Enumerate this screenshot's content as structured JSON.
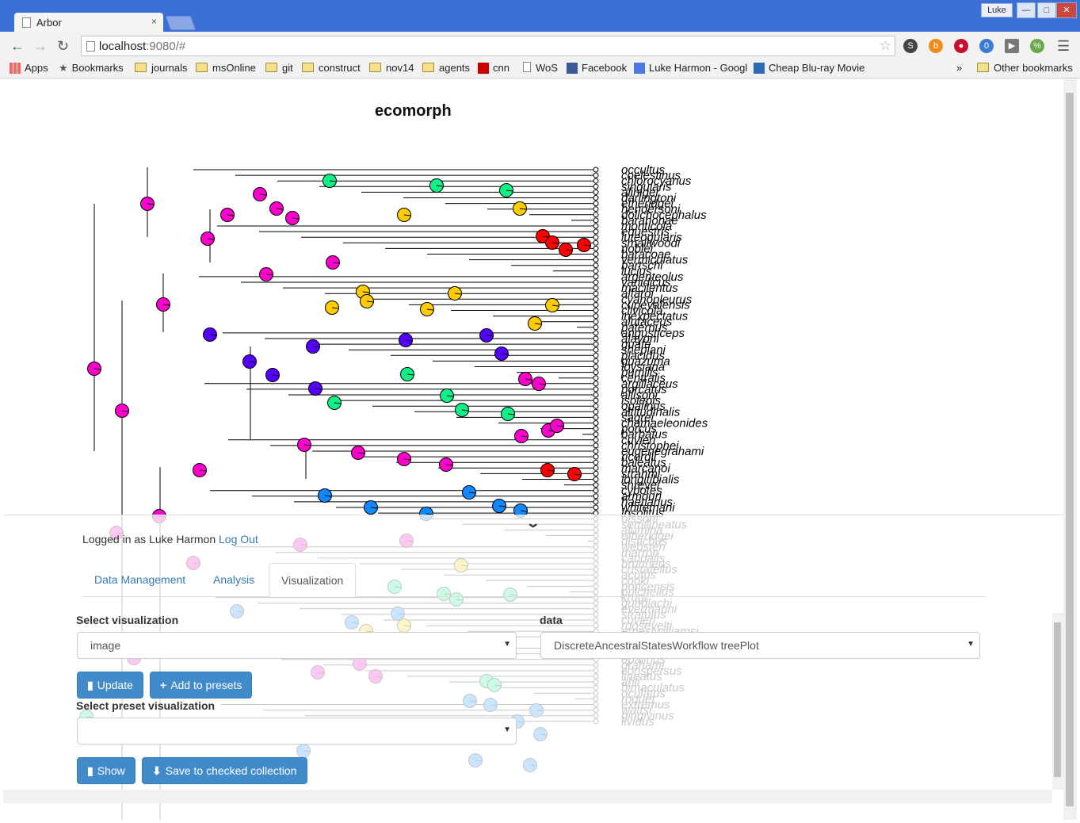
{
  "browser": {
    "tab_title": "Arbor",
    "tab_close": "×",
    "user": "Luke",
    "url_host": "localhost",
    "url_rest": ":9080/#",
    "ext_badge": "0",
    "bookmarks": [
      {
        "label": "Apps",
        "type": "grid"
      },
      {
        "label": "Bookmarks",
        "type": "star"
      },
      {
        "label": "journals",
        "type": "folder"
      },
      {
        "label": "msOnline",
        "type": "folder"
      },
      {
        "label": "git",
        "type": "folder"
      },
      {
        "label": "construct",
        "type": "folder"
      },
      {
        "label": "nov14",
        "type": "folder"
      },
      {
        "label": "agents",
        "type": "folder"
      },
      {
        "label": "cnn",
        "type": "cnn"
      },
      {
        "label": "WoS",
        "type": "page"
      },
      {
        "label": "Facebook",
        "type": "facebook"
      },
      {
        "label": "Luke Harmon - Googl",
        "type": "google"
      },
      {
        "label": "Cheap Blu-ray Movie",
        "type": "blog"
      }
    ],
    "more_chevron": "»",
    "other_bookmarks": "Other bookmarks"
  },
  "figure": {
    "title": "ecomorph",
    "tips": [
      "occultus",
      "coelestinus",
      "chlorocyanus",
      "singularis",
      "aliniger",
      "darlingtoni",
      "etheridgei",
      "hendersoni",
      "dolichocephalus",
      "barahonae",
      "monticola",
      "equestris",
      "luteogularis",
      "smallwoodi",
      "noblei",
      "baracoae",
      "vermiculatus",
      "bartschi",
      "lucius",
      "argenteolus",
      "vanidicus",
      "macilentus",
      "alfaroi",
      "cyanopleurus",
      "cupeyalensis",
      "clivicola",
      "inexpectatus",
      "alutaceus",
      "paternus",
      "angusticeps",
      "alayoni",
      "guafe",
      "sheplani",
      "placidus",
      "guazuma",
      "loysiana",
      "pumilis",
      "centralis",
      "argillaceus",
      "porcatus",
      "allisoni",
      "isolepis",
      "opalinus",
      "altitudinalis",
      "sagrei",
      "chamaeleonides",
      "porcus",
      "barbatus",
      "cuvieri",
      "christophei",
      "eugenegrahami",
      "ricordii",
      "baleatus",
      "marcanoi",
      "strahmi",
      "longitibialis",
      "shrevei",
      "cybotes",
      "armouri",
      "haetianus",
      "whitemani",
      "insolitus",
      "olssoni",
      "semilineatus",
      "alumina",
      "etheridgei",
      "distichus",
      "websteri",
      "marron",
      "caudalis",
      "brunneus",
      "cristatellus",
      "acutus",
      "cooki",
      "poncensis",
      "pulchellus",
      "krugi",
      "gundlachi",
      "evermanni",
      "stratulus",
      "cuvieri",
      "roosevelti",
      "ernestwilliamsi",
      "lineatopus",
      "reconditus",
      "valencienni",
      "garmani",
      "opalinus",
      "grahami",
      "conspersus",
      "lineatus",
      "ahli",
      "bimaculatus",
      "oculatus",
      "roquet",
      "extremus",
      "wattsi",
      "gingivinus",
      "lividus"
    ],
    "node_color_hex": {
      "magenta": "#ff00cc",
      "green": "#10f088",
      "yellow": "#ffcc00",
      "red": "#ff0000",
      "purple": "#5500ff",
      "blue": "#1188ff"
    }
  },
  "app": {
    "expand_chevron": "⌄",
    "logged_in_prefix": "Logged in as Luke Harmon",
    "logout": "Log Out",
    "tabs": [
      "Data Management",
      "Analysis",
      "Visualization"
    ],
    "active_tab": "Visualization",
    "select_viz_label": "Select visualization",
    "select_viz_value": "image",
    "data_label": "data",
    "data_value": "DiscreteAncestralStatesWorkflow treePlot",
    "update_label": "Update",
    "add_presets_label": "Add to presets",
    "select_preset_label": "Select preset visualization",
    "select_preset_value": "",
    "show_label": "Show",
    "save_label": "Save to checked collection"
  }
}
